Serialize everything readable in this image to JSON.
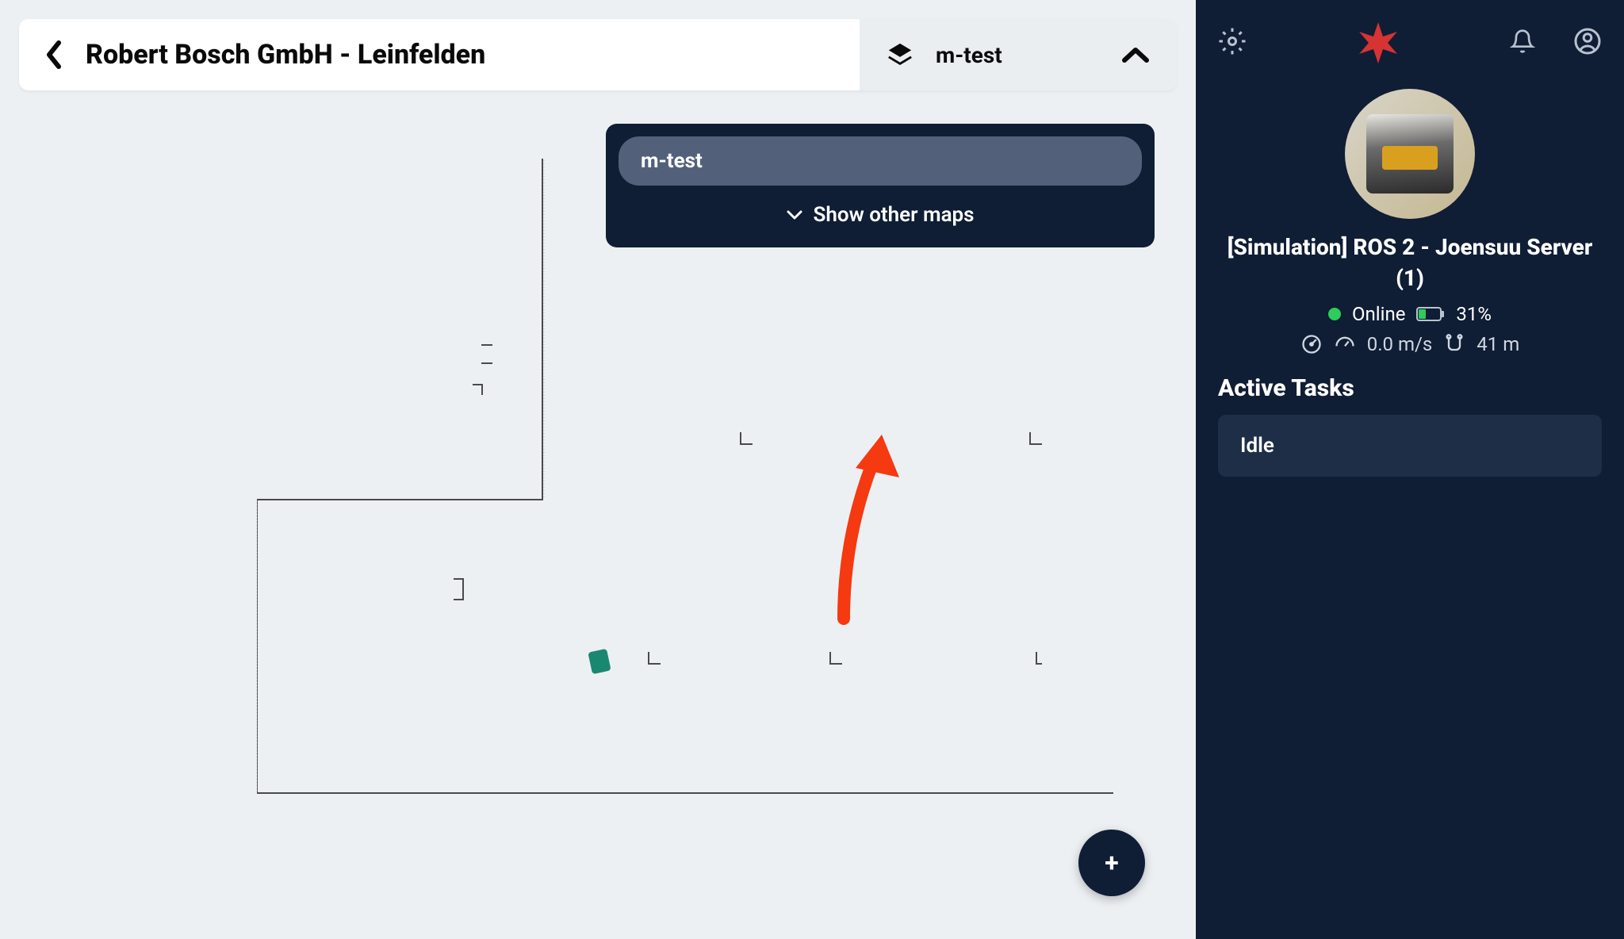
{
  "header": {
    "title": "Robert Bosch GmbH - Leinfelden",
    "selected_map": "m-test"
  },
  "dropdown": {
    "items": [
      "m-test"
    ],
    "show_other_label": "Show other maps"
  },
  "fab": {
    "label": "+"
  },
  "robot": {
    "name": "[Simulation] ROS 2 - Joensuu Server (1)",
    "status_label": "Online",
    "battery_percent": "31%",
    "speed": "0.0 m/s",
    "distance": "41 m"
  },
  "tasks": {
    "section_title": "Active Tasks",
    "items": [
      "Idle"
    ]
  }
}
